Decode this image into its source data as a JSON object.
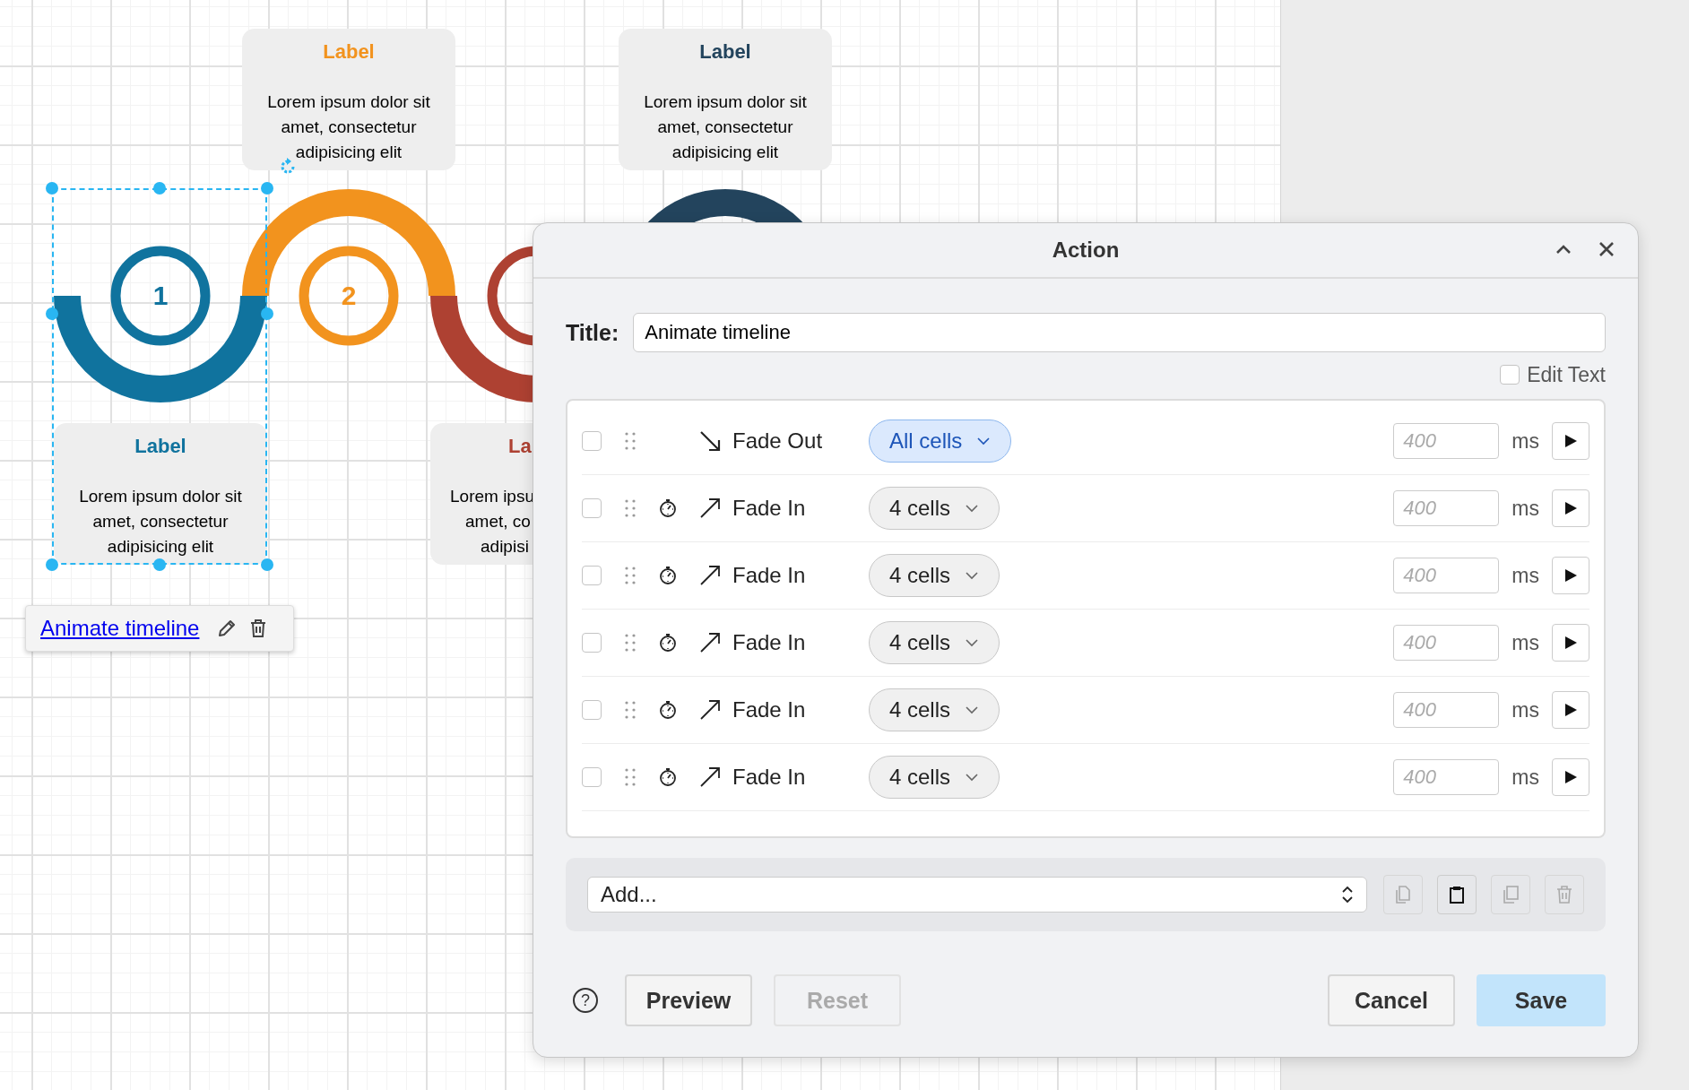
{
  "canvas": {
    "steps": [
      {
        "number": "1",
        "color": "#10739e",
        "selected": true,
        "card": {
          "heading": "Label",
          "body": "Lorem ipsum dolor sit amet, consectetur adipisicing elit"
        }
      },
      {
        "number": "2",
        "color": "#f2931e",
        "selected": false,
        "card": {
          "heading": "Label",
          "body": "Lorem ipsum dolor sit amet, consectetur adipisicing elit"
        }
      },
      {
        "color": "#ae4132",
        "selected": false,
        "card": {
          "heading": "La",
          "lines": [
            "Lorem ipsu",
            "amet, co",
            "adipisi"
          ]
        }
      },
      {
        "color": "#23445d",
        "selected": false,
        "card": {
          "heading": "Label",
          "body": "Lorem ipsum dolor sit amet, consectetur adipisicing elit"
        }
      }
    ],
    "link_popup": {
      "link": "Animate timeline"
    }
  },
  "dialog": {
    "title": "Action",
    "title_label": "Title:",
    "title_value": "Animate timeline",
    "edit_text": {
      "label": "Edit Text",
      "checked": false
    },
    "actions": [
      {
        "checked": false,
        "delayed": false,
        "kind": "fade-out",
        "label": "Fade Out",
        "target": {
          "label": "All cells",
          "selected": true
        },
        "duration_placeholder": "400",
        "unit": "ms"
      },
      {
        "checked": false,
        "delayed": true,
        "kind": "fade-in",
        "label": "Fade In",
        "target": {
          "label": "4 cells",
          "selected": false
        },
        "duration_placeholder": "400",
        "unit": "ms"
      },
      {
        "checked": false,
        "delayed": true,
        "kind": "fade-in",
        "label": "Fade In",
        "target": {
          "label": "4 cells",
          "selected": false
        },
        "duration_placeholder": "400",
        "unit": "ms"
      },
      {
        "checked": false,
        "delayed": true,
        "kind": "fade-in",
        "label": "Fade In",
        "target": {
          "label": "4 cells",
          "selected": false
        },
        "duration_placeholder": "400",
        "unit": "ms"
      },
      {
        "checked": false,
        "delayed": true,
        "kind": "fade-in",
        "label": "Fade In",
        "target": {
          "label": "4 cells",
          "selected": false
        },
        "duration_placeholder": "400",
        "unit": "ms"
      },
      {
        "checked": false,
        "delayed": true,
        "kind": "fade-in",
        "label": "Fade In",
        "target": {
          "label": "4 cells",
          "selected": false
        },
        "duration_placeholder": "400",
        "unit": "ms"
      }
    ],
    "add_select": {
      "value": "Add..."
    },
    "tools": [
      {
        "kind": "copy",
        "disabled": true
      },
      {
        "kind": "paste",
        "disabled": false
      },
      {
        "kind": "duplicate",
        "disabled": true
      },
      {
        "kind": "delete",
        "disabled": true
      }
    ],
    "help": "?",
    "footer_left": [
      {
        "label": "Preview",
        "disabled": false,
        "primary": false
      },
      {
        "label": "Reset",
        "disabled": true,
        "primary": false
      }
    ],
    "footer_right": [
      {
        "label": "Cancel",
        "disabled": false,
        "primary": false
      },
      {
        "label": "Save",
        "disabled": false,
        "primary": true
      }
    ]
  }
}
